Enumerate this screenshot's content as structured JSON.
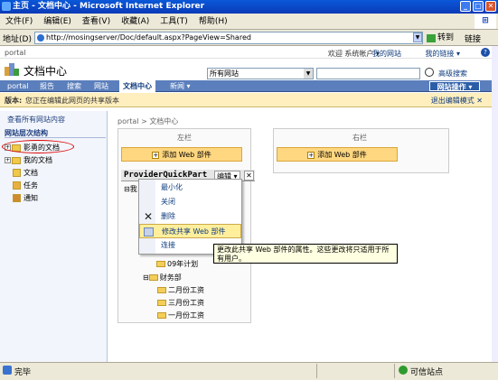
{
  "window": {
    "title": "主页 - 文档中心 - Microsoft Internet Explorer",
    "brand_color": "#0a3ab8"
  },
  "menu": [
    "文件(F)",
    "编辑(E)",
    "查看(V)",
    "收藏(A)",
    "工具(T)",
    "帮助(H)"
  ],
  "address": {
    "label": "地址(D)",
    "url": "http://mosingserver/Doc/default.aspx?PageView=Shared",
    "go_label": "转到",
    "links_label": "链接"
  },
  "top": {
    "breadcrumb": "portal",
    "welcome": "欢迎 系统帐户 ▾",
    "my_site": "我的网站",
    "my_links": "我的链接 ▾",
    "help": "?"
  },
  "site": {
    "title": "文档中心",
    "scope": "所有网站",
    "advanced_search": "高级搜索"
  },
  "nav_tabs": [
    "portal",
    "报告",
    "搜索",
    "网站",
    "文档中心",
    "新闻 ▾"
  ],
  "active_tab_index": 4,
  "site_actions": "网站操作 ▾",
  "edit_bar": {
    "version_label": "版本:",
    "message": "您正在编辑此网页的共享版本",
    "exit": "退出编辑模式 ✕"
  },
  "left_nav": {
    "view_all": "查看所有网站内容",
    "hierarchy_header": "网站层次结构",
    "items": [
      "影勇的文档",
      "我的文档",
      "文档",
      "任务",
      "通知"
    ]
  },
  "main": {
    "breadcrumb": "portal > 文档中心",
    "left_zone": "左栏",
    "right_zone": "右栏",
    "add_web_part": "添加 Web 部件",
    "web_part_title": "ProviderQuickPart",
    "edit_menu": "编辑 ▾",
    "close_symbol": "✕"
  },
  "tree_items": [
    {
      "label": "我",
      "prefix": "⊟"
    },
    {
      "label": "09年计划",
      "prefix": ""
    },
    {
      "label": "财务部",
      "prefix": "⊟"
    },
    {
      "label": "二月份工资",
      "prefix": ""
    },
    {
      "label": "三月份工资",
      "prefix": ""
    },
    {
      "label": "一月份工资",
      "prefix": ""
    }
  ],
  "dropdown": [
    {
      "label": "最小化",
      "icon": ""
    },
    {
      "label": "关闭",
      "icon": ""
    },
    {
      "label": "删除",
      "icon": "delete-icon"
    },
    {
      "label": "修改共享 Web 部件",
      "icon": "modify-icon"
    },
    {
      "label": "连接",
      "icon": ""
    }
  ],
  "tooltip": "更改此共享 Web 部件的属性。这些更改将只适用于所有用户。",
  "status": {
    "text": "完毕",
    "zone": "可信站点"
  },
  "colors": {
    "nav_blue": "#5b7fbd",
    "edit_bar": "#ffefbe",
    "add_button": "#ffd780",
    "highlight_ring": "#dd0000"
  }
}
